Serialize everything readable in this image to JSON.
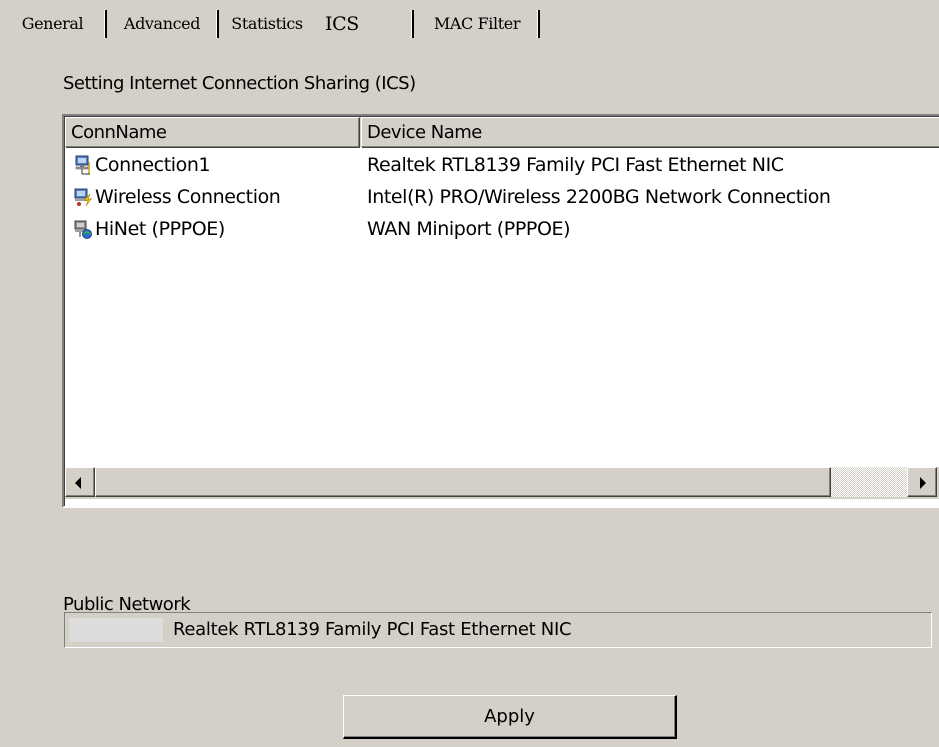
{
  "tabs": [
    {
      "label": "General"
    },
    {
      "label": "Advanced"
    },
    {
      "label": "Statistics"
    },
    {
      "label": "ICS",
      "active": true
    },
    {
      "label": "MAC Filter"
    }
  ],
  "ics": {
    "section_label": "Setting Internet Connection Sharing (ICS)",
    "columns": {
      "conn_name": "ConnName",
      "device_name": "Device Name"
    },
    "rows": [
      {
        "name": "Connection1",
        "device": "Realtek RTL8139 Family PCI Fast Ethernet NIC",
        "icon": "lan-connection-icon"
      },
      {
        "name": "Wireless Connection",
        "device": "Intel(R) PRO/Wireless 2200BG Network Connection",
        "icon": "wireless-connection-icon"
      },
      {
        "name": "HiNet (PPPOE)",
        "device": "WAN Miniport (PPPOE)",
        "icon": "broadband-connection-icon"
      }
    ]
  },
  "public_network": {
    "label": "Public Network",
    "value": "Realtek RTL8139 Family PCI Fast Ethernet NIC"
  },
  "apply_label": "Apply",
  "colors": {
    "dialog_bg": "#d4d0c8",
    "list_bg": "#ffffff"
  }
}
